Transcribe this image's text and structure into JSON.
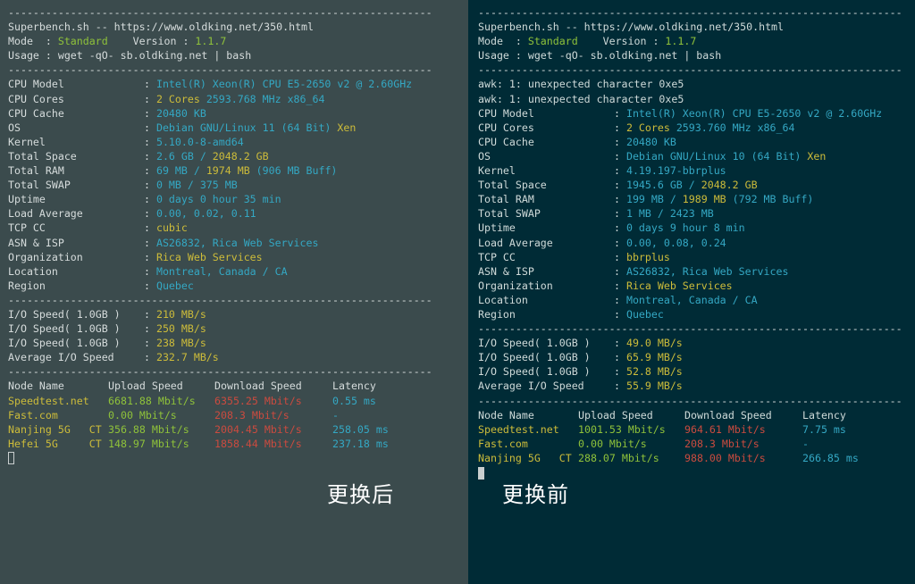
{
  "separator": "--------------------------------------------------------------------",
  "panels": [
    {
      "id": "left",
      "caption": "更换后",
      "header": {
        "title": "Superbench.sh -- https://www.oldking.net/350.html",
        "mode_label": "Mode  : ",
        "mode_value": "Standard",
        "version_label": "    Version : ",
        "version_value": "1.1.7",
        "usage": "Usage : wget -qO- sb.oldking.net | bash"
      },
      "warnings": [],
      "sysinfo": [
        {
          "label": "CPU Model",
          "parts": [
            {
              "t": "Intel(R) Xeon(R) CPU E5-2650 v2 @ 2.60GHz",
              "c": "cyan"
            }
          ]
        },
        {
          "label": "CPU Cores",
          "parts": [
            {
              "t": "2 Cores",
              "c": "yellow"
            },
            {
              "t": " 2593.768 MHz x86_64",
              "c": "cyan"
            }
          ]
        },
        {
          "label": "CPU Cache",
          "parts": [
            {
              "t": "20480 KB",
              "c": "cyan"
            }
          ]
        },
        {
          "label": "OS",
          "parts": [
            {
              "t": "Debian GNU/Linux 11 (64 Bit) ",
              "c": "cyan"
            },
            {
              "t": "Xen",
              "c": "yellow"
            }
          ]
        },
        {
          "label": "Kernel",
          "parts": [
            {
              "t": "5.10.0-8-amd64",
              "c": "cyan"
            }
          ]
        },
        {
          "label": "Total Space",
          "parts": [
            {
              "t": "2.6 GB / ",
              "c": "cyan"
            },
            {
              "t": "2048.2 GB",
              "c": "yellow"
            }
          ]
        },
        {
          "label": "Total RAM",
          "parts": [
            {
              "t": "69 MB / ",
              "c": "cyan"
            },
            {
              "t": "1974 MB",
              "c": "yellow"
            },
            {
              "t": " (906 MB Buff)",
              "c": "cyan"
            }
          ]
        },
        {
          "label": "Total SWAP",
          "parts": [
            {
              "t": "0 MB / 375 MB",
              "c": "cyan"
            }
          ]
        },
        {
          "label": "Uptime",
          "parts": [
            {
              "t": "0 days 0 hour 35 min",
              "c": "cyan"
            }
          ]
        },
        {
          "label": "Load Average",
          "parts": [
            {
              "t": "0.00, 0.02, 0.11",
              "c": "cyan"
            }
          ]
        },
        {
          "label": "TCP CC",
          "parts": [
            {
              "t": "cubic",
              "c": "yellow"
            }
          ]
        },
        {
          "label": "ASN & ISP",
          "parts": [
            {
              "t": "AS26832, Rica Web Services",
              "c": "cyan"
            }
          ]
        },
        {
          "label": "Organization",
          "parts": [
            {
              "t": "Rica Web Services",
              "c": "yellow"
            }
          ]
        },
        {
          "label": "Location",
          "parts": [
            {
              "t": "Montreal, Canada / CA",
              "c": "cyan"
            }
          ]
        },
        {
          "label": "Region",
          "parts": [
            {
              "t": "Quebec",
              "c": "cyan"
            }
          ]
        }
      ],
      "io": [
        {
          "label": "I/O Speed( 1.0GB )",
          "value": "210 MB/s"
        },
        {
          "label": "I/O Speed( 1.0GB )",
          "value": "250 MB/s"
        },
        {
          "label": "I/O Speed( 1.0GB )",
          "value": "238 MB/s"
        },
        {
          "label": "Average I/O Speed",
          "value": "232.7 MB/s"
        }
      ],
      "speed_headers": [
        "Node Name",
        "Upload Speed",
        "Download Speed",
        "Latency"
      ],
      "speed_rows": [
        {
          "node": "Speedtest.net",
          "up": "6681.88 Mbit/s",
          "down": "6355.25 Mbit/s",
          "lat": "0.55 ms"
        },
        {
          "node": "Fast.com",
          "up": "0.00 Mbit/s",
          "down": "208.3 Mbit/s",
          "lat": "-"
        },
        {
          "node": "Nanjing 5G   CT",
          "up": "356.88 Mbit/s",
          "down": "2004.45 Mbit/s",
          "lat": "258.05 ms"
        },
        {
          "node": "Hefei 5G     CT",
          "up": "148.97 Mbit/s",
          "down": "1858.44 Mbit/s",
          "lat": "237.18 ms"
        }
      ]
    },
    {
      "id": "right",
      "caption": "更换前",
      "header": {
        "title": "Superbench.sh -- https://www.oldking.net/350.html",
        "mode_label": "Mode  : ",
        "mode_value": "Standard",
        "version_label": "    Version : ",
        "version_value": "1.1.7",
        "usage": "Usage : wget -qO- sb.oldking.net | bash"
      },
      "warnings": [
        "awk: 1: unexpected character 0xe5",
        "awk: 1: unexpected character 0xe5"
      ],
      "sysinfo": [
        {
          "label": "CPU Model",
          "parts": [
            {
              "t": "Intel(R) Xeon(R) CPU E5-2650 v2 @ 2.60GHz",
              "c": "cyan"
            }
          ]
        },
        {
          "label": "CPU Cores",
          "parts": [
            {
              "t": "2 Cores",
              "c": "yellow"
            },
            {
              "t": " 2593.760 MHz x86_64",
              "c": "cyan"
            }
          ]
        },
        {
          "label": "CPU Cache",
          "parts": [
            {
              "t": "20480 KB",
              "c": "cyan"
            }
          ]
        },
        {
          "label": "OS",
          "parts": [
            {
              "t": "Debian GNU/Linux 10 (64 Bit) ",
              "c": "cyan"
            },
            {
              "t": "Xen",
              "c": "yellow"
            }
          ]
        },
        {
          "label": "Kernel",
          "parts": [
            {
              "t": "4.19.197-bbrplus",
              "c": "cyan"
            }
          ]
        },
        {
          "label": "Total Space",
          "parts": [
            {
              "t": "1945.6 GB / ",
              "c": "cyan"
            },
            {
              "t": "2048.2 GB",
              "c": "yellow"
            }
          ]
        },
        {
          "label": "Total RAM",
          "parts": [
            {
              "t": "199 MB / ",
              "c": "cyan"
            },
            {
              "t": "1989 MB",
              "c": "yellow"
            },
            {
              "t": " (792 MB Buff)",
              "c": "cyan"
            }
          ]
        },
        {
          "label": "Total SWAP",
          "parts": [
            {
              "t": "1 MB / 2423 MB",
              "c": "cyan"
            }
          ]
        },
        {
          "label": "Uptime",
          "parts": [
            {
              "t": "0 days 9 hour 8 min",
              "c": "cyan"
            }
          ]
        },
        {
          "label": "Load Average",
          "parts": [
            {
              "t": "0.00, 0.08, 0.24",
              "c": "cyan"
            }
          ]
        },
        {
          "label": "TCP CC",
          "parts": [
            {
              "t": "bbrplus",
              "c": "yellow"
            }
          ]
        },
        {
          "label": "ASN & ISP",
          "parts": [
            {
              "t": "AS26832, Rica Web Services",
              "c": "cyan"
            }
          ]
        },
        {
          "label": "Organization",
          "parts": [
            {
              "t": "Rica Web Services",
              "c": "yellow"
            }
          ]
        },
        {
          "label": "Location",
          "parts": [
            {
              "t": "Montreal, Canada / CA",
              "c": "cyan"
            }
          ]
        },
        {
          "label": "Region",
          "parts": [
            {
              "t": "Quebec",
              "c": "cyan"
            }
          ]
        }
      ],
      "io": [
        {
          "label": "I/O Speed( 1.0GB )",
          "value": "49.0 MB/s"
        },
        {
          "label": "I/O Speed( 1.0GB )",
          "value": "65.9 MB/s"
        },
        {
          "label": "I/O Speed( 1.0GB )",
          "value": "52.8 MB/s"
        },
        {
          "label": "Average I/O Speed",
          "value": "55.9 MB/s"
        }
      ],
      "speed_headers": [
        "Node Name",
        "Upload Speed",
        "Download Speed",
        "Latency"
      ],
      "speed_rows": [
        {
          "node": "Speedtest.net",
          "up": "1001.53 Mbit/s",
          "down": "964.61 Mbit/s",
          "lat": "7.75 ms"
        },
        {
          "node": "Fast.com",
          "up": "0.00 Mbit/s",
          "down": "208.3 Mbit/s",
          "lat": "-"
        },
        {
          "node": "Nanjing 5G   CT",
          "up": "288.07 Mbit/s",
          "down": "988.00 Mbit/s",
          "lat": "266.85 ms"
        }
      ]
    }
  ]
}
